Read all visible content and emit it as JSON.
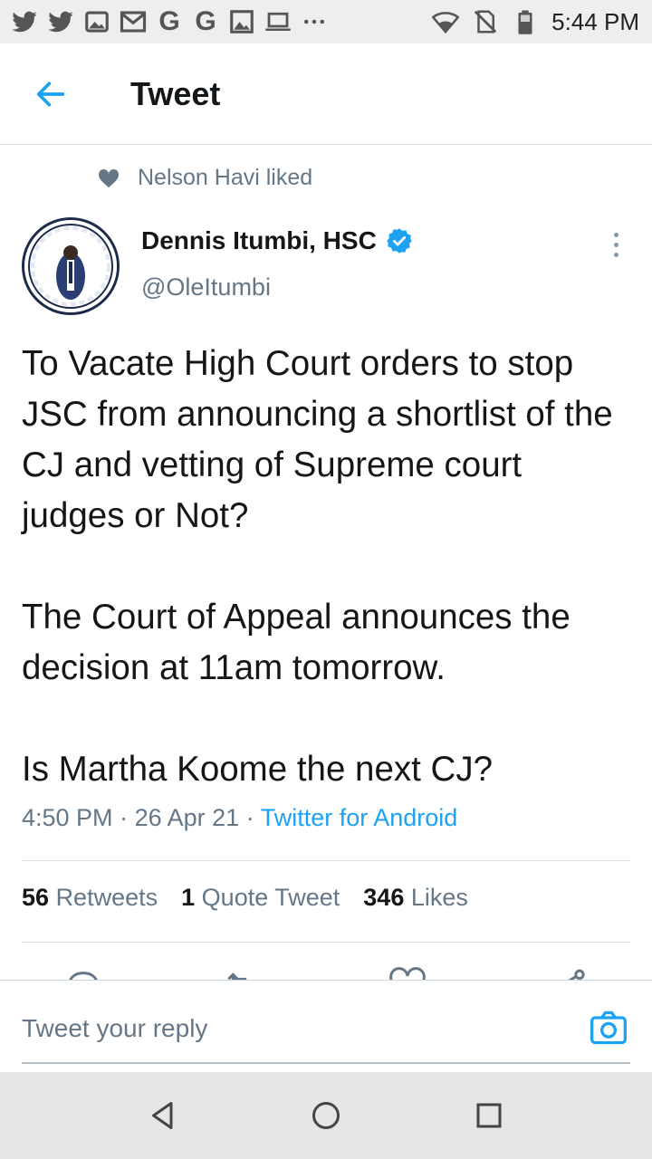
{
  "status_bar": {
    "time": "5:44 PM",
    "left_icons": [
      "twitter-icon",
      "twitter-icon",
      "image-icon",
      "gmail-icon",
      "google-icon",
      "google-icon",
      "photo-icon",
      "laptop-icon",
      "more-icon"
    ],
    "google_letter": "G",
    "right_icons": [
      "wifi-icon",
      "no-sim-icon",
      "battery-icon"
    ]
  },
  "header": {
    "title": "Tweet"
  },
  "social_context": {
    "text": "Nelson Havi liked"
  },
  "author": {
    "name": "Dennis Itumbi, HSC",
    "handle": "@OleItumbi",
    "avatar_text_top": "I'VE GOT",
    "avatar_text_bottom": "YOUR BACK"
  },
  "tweet": {
    "paragraph_1": "To Vacate High Court orders to stop JSC from announcing a shortlist of the CJ and vetting of Supreme court judges or Not?",
    "paragraph_2": "The Court of Appeal announces the decision at 11am tomorrow.",
    "paragraph_3": "Is Martha Koome the next CJ?",
    "time": "4:50 PM",
    "sep": "·",
    "date": "26 Apr 21",
    "source": "Twitter for Android"
  },
  "stats": {
    "retweets_count": "56",
    "retweets_label": "Retweets",
    "quotes_count": "1",
    "quotes_label": "Quote Tweet",
    "likes_count": "346",
    "likes_label": "Likes"
  },
  "reply": {
    "placeholder": "Tweet your reply"
  },
  "colors": {
    "accent": "#1da1f2",
    "secondary_text": "#657786",
    "primary_text": "#14171a"
  }
}
